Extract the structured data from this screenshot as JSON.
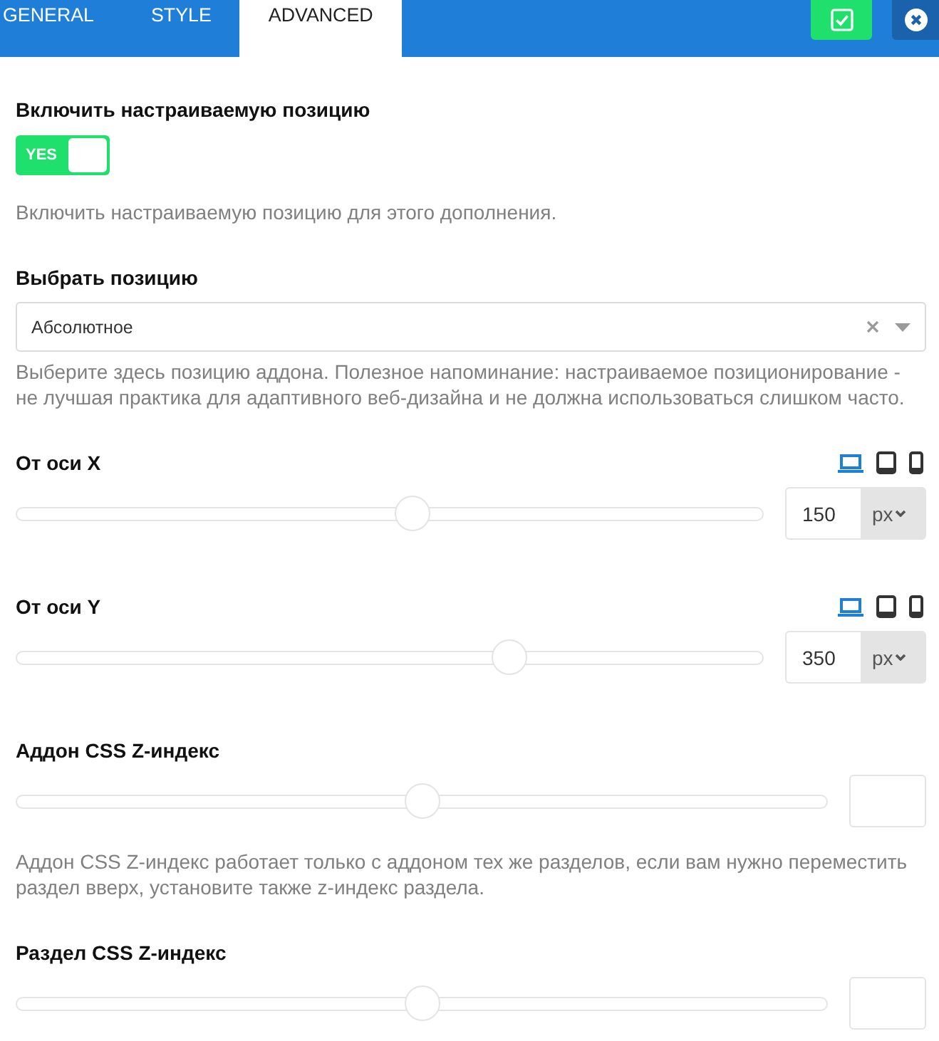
{
  "tabs": [
    {
      "label": "GENERAL",
      "selected": false
    },
    {
      "label": "STYLE",
      "selected": false
    },
    {
      "label": "ADVANCED",
      "selected": true
    }
  ],
  "fields": [
    {
      "kind": "toggle",
      "label": "Включить настраиваемую позицию",
      "on": true,
      "switch_text": "YES",
      "description": "Включить настраиваемую позицию для этого дополнения."
    },
    {
      "kind": "select",
      "label": "Выбрать позицию",
      "value": "Абсолютное",
      "description": "Выберите здесь позицию аддона. Полезное напоминание: настраиваемое позиционирование - не лучшая практика для адаптивного веб-дизайна и не должна использоваться слишком часто."
    },
    {
      "kind": "slider",
      "label": "От оси X",
      "devices": [
        {
          "kind": "desktop",
          "selected": true
        },
        {
          "kind": "tablet",
          "selected": false
        },
        {
          "kind": "mobile",
          "selected": false
        }
      ],
      "level": 0.53,
      "value": "150",
      "unit": "px"
    },
    {
      "kind": "slider",
      "label": "От оси Y",
      "devices": [
        {
          "kind": "desktop",
          "selected": true
        },
        {
          "kind": "tablet",
          "selected": false
        },
        {
          "kind": "mobile",
          "selected": false
        }
      ],
      "level": 0.66,
      "value": "350",
      "unit": "px"
    },
    {
      "kind": "slider",
      "label": "Аддон CSS Z-индекс",
      "level": 0.5,
      "description": "Аддон CSS Z-индекс работает только с аддоном тех же разделов, если вам нужно переместить раздел вверх, установите также z-индекс раздела."
    },
    {
      "kind": "slider",
      "label": "Раздел CSS Z-индекс",
      "level": 0.5
    }
  ]
}
